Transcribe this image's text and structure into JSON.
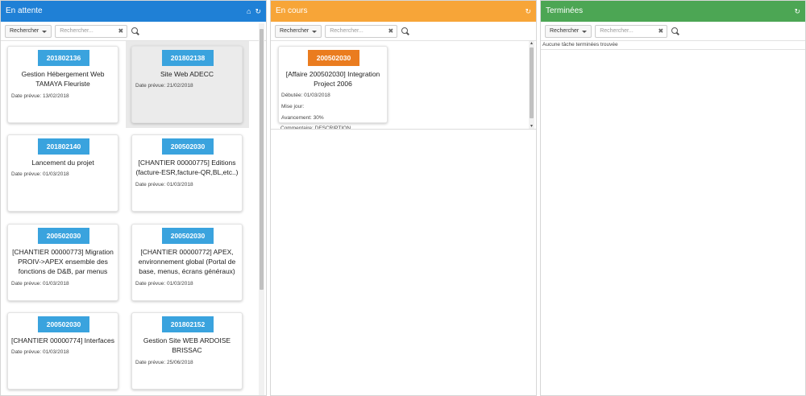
{
  "panels": [
    {
      "title": "En attente",
      "icons": [
        "home-icon",
        "refresh-icon"
      ],
      "search_button": "Rechercher",
      "search_placeholder": "Rechercher...",
      "cards": [
        {
          "id": "201802136",
          "title": "Gestion Hébergement Web TAMAYA Fleuriste",
          "date": "Date prévue: 13/02/2018"
        },
        {
          "id": "201802138",
          "title": "Site Web ADECC",
          "date": "Date prévue: 21/02/2018",
          "selected": true
        },
        {
          "id": "201802140",
          "title": "Lancement du projet",
          "date": "Date prévue: 01/03/2018"
        },
        {
          "id": "200502030",
          "title": "[CHANTIER 00000775] Editions (facture-ESR,facture-QR,BL,etc..)",
          "date": "Date prévue: 01/03/2018"
        },
        {
          "id": "200502030",
          "title": "[CHANTIER 00000773] Migration PROIV->APEX ensemble des fonctions de D&B, par menus",
          "date": "Date prévue: 01/03/2018"
        },
        {
          "id": "200502030",
          "title": "[CHANTIER 00000772] APEX, environnement global (Portal de base, menus, écrans généraux)",
          "date": "Date prévue: 01/03/2018"
        },
        {
          "id": "200502030",
          "title": "[CHANTIER 00000774] Interfaces",
          "date": "Date prévue: 01/03/2018"
        },
        {
          "id": "201802152",
          "title": "Gestion Site WEB ARDOISE BRISSAC",
          "date": "Date prévue: 25/06/2018"
        }
      ]
    },
    {
      "title": "En cours",
      "icons": [
        "refresh-icon"
      ],
      "search_button": "Rechercher",
      "search_placeholder": "Rechercher...",
      "cards": [
        {
          "id": "200502030",
          "title": "[Affaire 200502030] Integration Project 2006",
          "started": "Débutée: 01/03/2018",
          "mise_jour": "Mise jour:",
          "avancement": "Avancement: 30%",
          "commentaire": "Commentaire: DESCRIPTION"
        }
      ]
    },
    {
      "title": "Terminées",
      "icons": [
        "refresh-icon"
      ],
      "search_button": "Rechercher",
      "search_placeholder": "Rechercher...",
      "empty_text": "Aucune tâche terminées trouvée"
    }
  ],
  "colors": {
    "blue_header": "#1f80d6",
    "orange_header": "#f7a538",
    "green_header": "#4ca654",
    "badge_blue": "#3aa3de",
    "badge_orange": "#ea7c1f"
  }
}
